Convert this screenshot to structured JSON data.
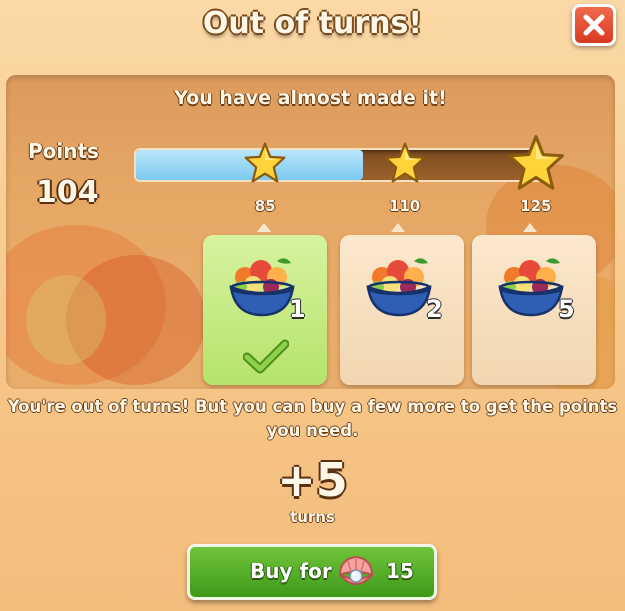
{
  "dialog": {
    "title": "Out of turns!",
    "subtitle": "You have almost made it!"
  },
  "progress": {
    "points_label": "Points",
    "points_value": "104",
    "current_points": 104,
    "max_points": 125,
    "fill_fraction": 0.56,
    "milestones": [
      {
        "label": "85",
        "value": 85,
        "star_fraction": 0.32
      },
      {
        "label": "110",
        "value": 110,
        "star_fraction": 0.66
      },
      {
        "label": "125",
        "value": 125,
        "star_fraction": 0.98
      }
    ]
  },
  "rewards": [
    {
      "count": "1",
      "achieved": true,
      "icon": "fruit-bowl-icon"
    },
    {
      "count": "2",
      "achieved": false,
      "icon": "fruit-bowl-icon"
    },
    {
      "count": "5",
      "achieved": false,
      "icon": "fruit-bowl-icon"
    }
  ],
  "message": "You're out of turns! But you can buy a few more to get the points you need.",
  "offer": {
    "amount": "+5",
    "unit": "turns",
    "buy_label": "Buy for",
    "price": "15",
    "currency_icon": "pearl-shell-icon"
  },
  "colors": {
    "progress_fill": "#7cc9ef",
    "buy_button": "#4fae24",
    "close_button": "#e04a2e",
    "achieved_card": "#c4ea80"
  }
}
